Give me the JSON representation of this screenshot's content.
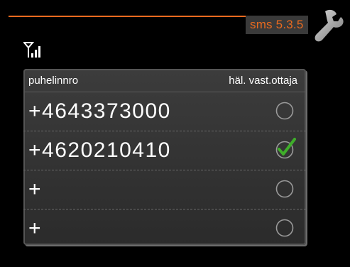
{
  "header": {
    "menu_code": "sms 5.3.5"
  },
  "icons": {
    "wrench": "wrench-icon",
    "signal": "signal-strength-icon"
  },
  "colors": {
    "accent": "#e86a1f",
    "check": "#3fae2a",
    "background": "#000000",
    "panel": "#333333"
  },
  "table": {
    "col_phone": "puhelinnro",
    "col_alarm": "häl. vast.ottaja",
    "rows": [
      {
        "phone": "+4643373000",
        "alarm_receiver": false
      },
      {
        "phone": "+4620210410",
        "alarm_receiver": true
      },
      {
        "phone": "+",
        "alarm_receiver": false
      },
      {
        "phone": "+",
        "alarm_receiver": false
      }
    ]
  }
}
